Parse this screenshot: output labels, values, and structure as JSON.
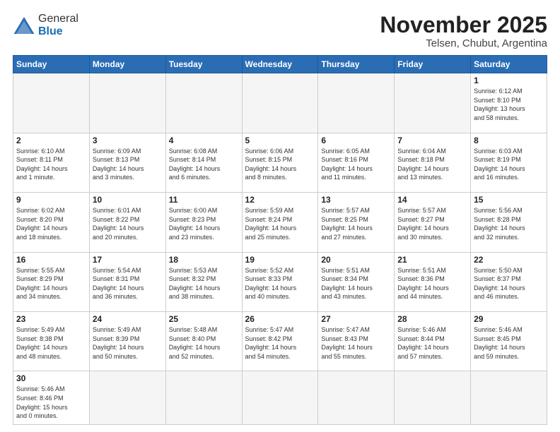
{
  "header": {
    "logo_general": "General",
    "logo_blue": "Blue",
    "month": "November 2025",
    "location": "Telsen, Chubut, Argentina"
  },
  "weekdays": [
    "Sunday",
    "Monday",
    "Tuesday",
    "Wednesday",
    "Thursday",
    "Friday",
    "Saturday"
  ],
  "weeks": [
    [
      {
        "day": "",
        "info": ""
      },
      {
        "day": "",
        "info": ""
      },
      {
        "day": "",
        "info": ""
      },
      {
        "day": "",
        "info": ""
      },
      {
        "day": "",
        "info": ""
      },
      {
        "day": "",
        "info": ""
      },
      {
        "day": "1",
        "info": "Sunrise: 6:12 AM\nSunset: 8:10 PM\nDaylight: 13 hours\nand 58 minutes."
      }
    ],
    [
      {
        "day": "2",
        "info": "Sunrise: 6:10 AM\nSunset: 8:11 PM\nDaylight: 14 hours\nand 1 minute."
      },
      {
        "day": "3",
        "info": "Sunrise: 6:09 AM\nSunset: 8:13 PM\nDaylight: 14 hours\nand 3 minutes."
      },
      {
        "day": "4",
        "info": "Sunrise: 6:08 AM\nSunset: 8:14 PM\nDaylight: 14 hours\nand 6 minutes."
      },
      {
        "day": "5",
        "info": "Sunrise: 6:06 AM\nSunset: 8:15 PM\nDaylight: 14 hours\nand 8 minutes."
      },
      {
        "day": "6",
        "info": "Sunrise: 6:05 AM\nSunset: 8:16 PM\nDaylight: 14 hours\nand 11 minutes."
      },
      {
        "day": "7",
        "info": "Sunrise: 6:04 AM\nSunset: 8:18 PM\nDaylight: 14 hours\nand 13 minutes."
      },
      {
        "day": "8",
        "info": "Sunrise: 6:03 AM\nSunset: 8:19 PM\nDaylight: 14 hours\nand 16 minutes."
      }
    ],
    [
      {
        "day": "9",
        "info": "Sunrise: 6:02 AM\nSunset: 8:20 PM\nDaylight: 14 hours\nand 18 minutes."
      },
      {
        "day": "10",
        "info": "Sunrise: 6:01 AM\nSunset: 8:22 PM\nDaylight: 14 hours\nand 20 minutes."
      },
      {
        "day": "11",
        "info": "Sunrise: 6:00 AM\nSunset: 8:23 PM\nDaylight: 14 hours\nand 23 minutes."
      },
      {
        "day": "12",
        "info": "Sunrise: 5:59 AM\nSunset: 8:24 PM\nDaylight: 14 hours\nand 25 minutes."
      },
      {
        "day": "13",
        "info": "Sunrise: 5:57 AM\nSunset: 8:25 PM\nDaylight: 14 hours\nand 27 minutes."
      },
      {
        "day": "14",
        "info": "Sunrise: 5:57 AM\nSunset: 8:27 PM\nDaylight: 14 hours\nand 30 minutes."
      },
      {
        "day": "15",
        "info": "Sunrise: 5:56 AM\nSunset: 8:28 PM\nDaylight: 14 hours\nand 32 minutes."
      }
    ],
    [
      {
        "day": "16",
        "info": "Sunrise: 5:55 AM\nSunset: 8:29 PM\nDaylight: 14 hours\nand 34 minutes."
      },
      {
        "day": "17",
        "info": "Sunrise: 5:54 AM\nSunset: 8:31 PM\nDaylight: 14 hours\nand 36 minutes."
      },
      {
        "day": "18",
        "info": "Sunrise: 5:53 AM\nSunset: 8:32 PM\nDaylight: 14 hours\nand 38 minutes."
      },
      {
        "day": "19",
        "info": "Sunrise: 5:52 AM\nSunset: 8:33 PM\nDaylight: 14 hours\nand 40 minutes."
      },
      {
        "day": "20",
        "info": "Sunrise: 5:51 AM\nSunset: 8:34 PM\nDaylight: 14 hours\nand 43 minutes."
      },
      {
        "day": "21",
        "info": "Sunrise: 5:51 AM\nSunset: 8:36 PM\nDaylight: 14 hours\nand 44 minutes."
      },
      {
        "day": "22",
        "info": "Sunrise: 5:50 AM\nSunset: 8:37 PM\nDaylight: 14 hours\nand 46 minutes."
      }
    ],
    [
      {
        "day": "23",
        "info": "Sunrise: 5:49 AM\nSunset: 8:38 PM\nDaylight: 14 hours\nand 48 minutes."
      },
      {
        "day": "24",
        "info": "Sunrise: 5:49 AM\nSunset: 8:39 PM\nDaylight: 14 hours\nand 50 minutes."
      },
      {
        "day": "25",
        "info": "Sunrise: 5:48 AM\nSunset: 8:40 PM\nDaylight: 14 hours\nand 52 minutes."
      },
      {
        "day": "26",
        "info": "Sunrise: 5:47 AM\nSunset: 8:42 PM\nDaylight: 14 hours\nand 54 minutes."
      },
      {
        "day": "27",
        "info": "Sunrise: 5:47 AM\nSunset: 8:43 PM\nDaylight: 14 hours\nand 55 minutes."
      },
      {
        "day": "28",
        "info": "Sunrise: 5:46 AM\nSunset: 8:44 PM\nDaylight: 14 hours\nand 57 minutes."
      },
      {
        "day": "29",
        "info": "Sunrise: 5:46 AM\nSunset: 8:45 PM\nDaylight: 14 hours\nand 59 minutes."
      }
    ],
    [
      {
        "day": "30",
        "info": "Sunrise: 5:46 AM\nSunset: 8:46 PM\nDaylight: 15 hours\nand 0 minutes."
      },
      {
        "day": "",
        "info": ""
      },
      {
        "day": "",
        "info": ""
      },
      {
        "day": "",
        "info": ""
      },
      {
        "day": "",
        "info": ""
      },
      {
        "day": "",
        "info": ""
      },
      {
        "day": "",
        "info": ""
      }
    ]
  ]
}
